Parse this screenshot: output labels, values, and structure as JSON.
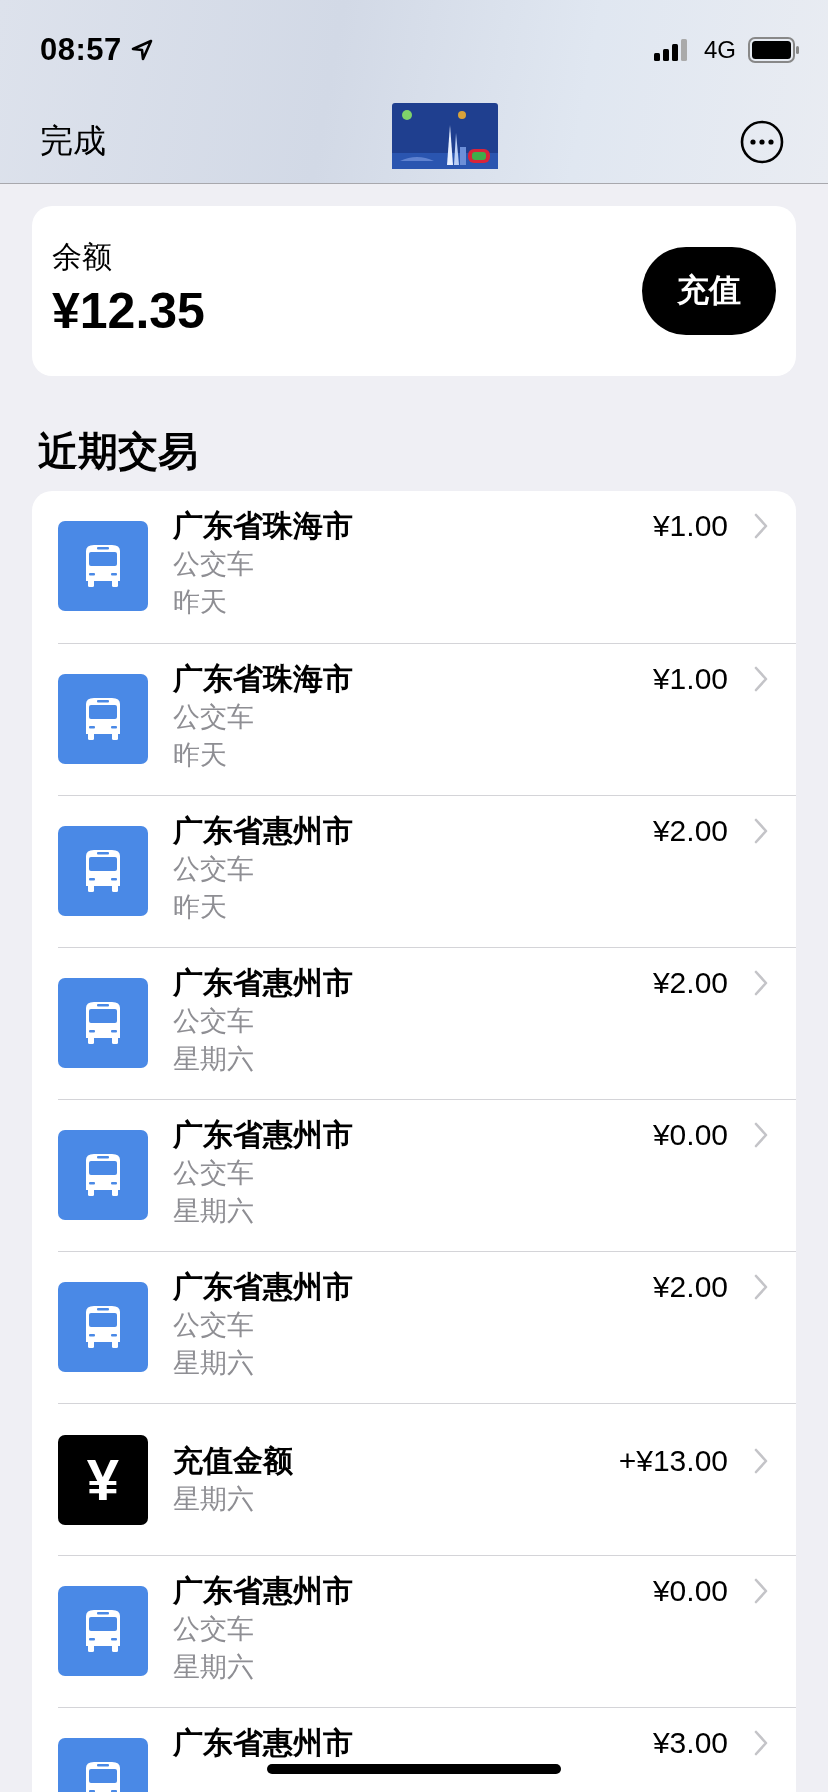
{
  "status_bar": {
    "time": "08:57",
    "network": "4G"
  },
  "nav": {
    "done": "完成"
  },
  "balance": {
    "label": "余额",
    "amount": "¥12.35",
    "button": "充值"
  },
  "section_title": "近期交易",
  "transactions": [
    {
      "kind": "bus",
      "title": "广东省珠海市",
      "amount": "¥1.00",
      "lines": [
        "公交车",
        "昨天"
      ]
    },
    {
      "kind": "bus",
      "title": "广东省珠海市",
      "amount": "¥1.00",
      "lines": [
        "公交车",
        "昨天"
      ]
    },
    {
      "kind": "bus",
      "title": "广东省惠州市",
      "amount": "¥2.00",
      "lines": [
        "公交车",
        "昨天"
      ]
    },
    {
      "kind": "bus",
      "title": "广东省惠州市",
      "amount": "¥2.00",
      "lines": [
        "公交车",
        "星期六"
      ]
    },
    {
      "kind": "bus",
      "title": "广东省惠州市",
      "amount": "¥0.00",
      "lines": [
        "公交车",
        "星期六"
      ]
    },
    {
      "kind": "bus",
      "title": "广东省惠州市",
      "amount": "¥2.00",
      "lines": [
        "公交车",
        "星期六"
      ]
    },
    {
      "kind": "recharge",
      "icon_glyph": "¥",
      "title": "充值金额",
      "amount": "+¥13.00",
      "lines": [
        "星期六"
      ]
    },
    {
      "kind": "bus",
      "title": "广东省惠州市",
      "amount": "¥0.00",
      "lines": [
        "公交车",
        "星期六"
      ]
    },
    {
      "kind": "bus",
      "title": "广东省惠州市",
      "amount": "¥3.00"
    }
  ]
}
